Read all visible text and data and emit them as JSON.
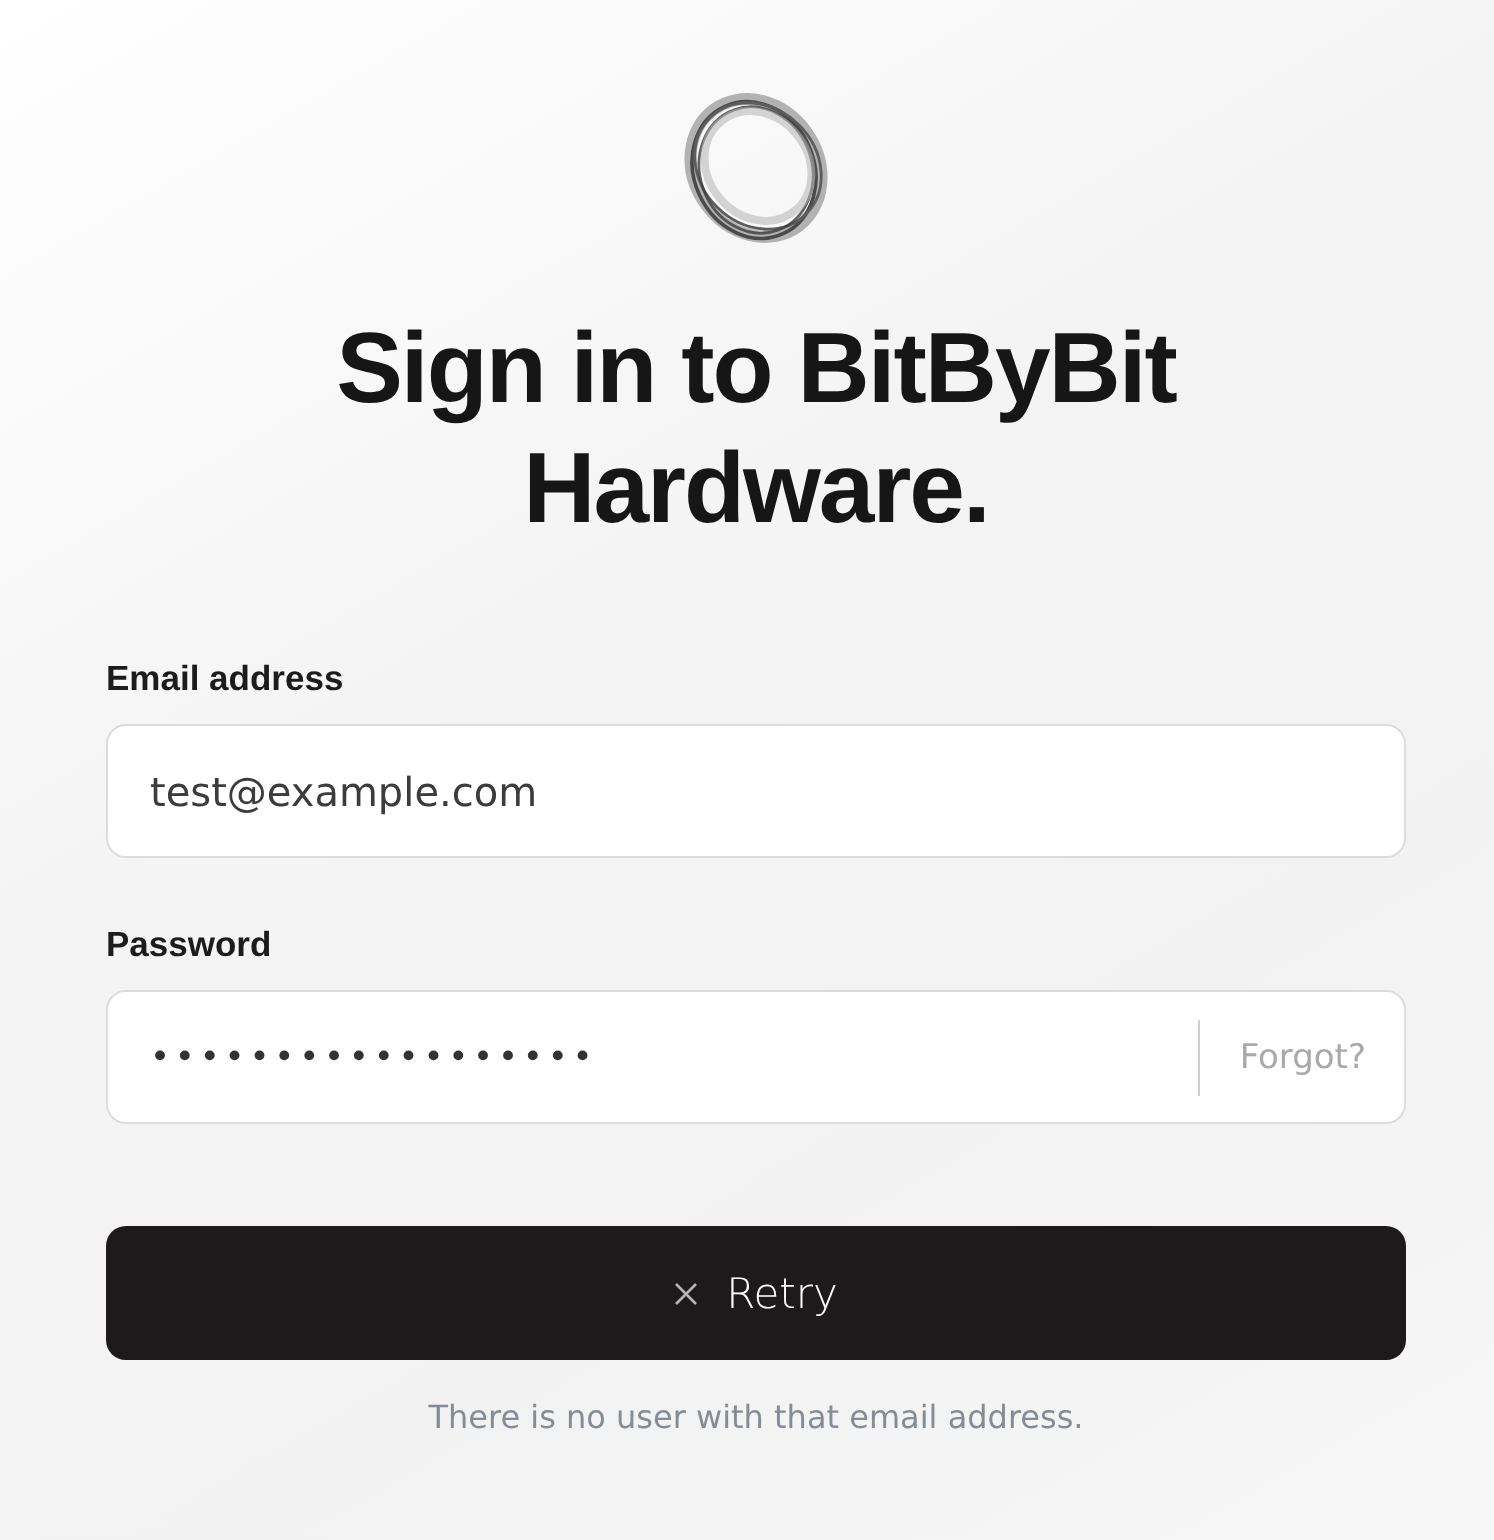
{
  "title": "Sign in to BitByBit Hardware.",
  "fields": [
    {
      "kind": "text",
      "label": "Email address",
      "value": "test@example.com"
    },
    {
      "kind": "password",
      "label": "Password",
      "value": "••••••••••••••••••",
      "link": "Forgot?"
    }
  ],
  "submit": {
    "label": "Retry"
  },
  "error": "There is no user with that email address."
}
